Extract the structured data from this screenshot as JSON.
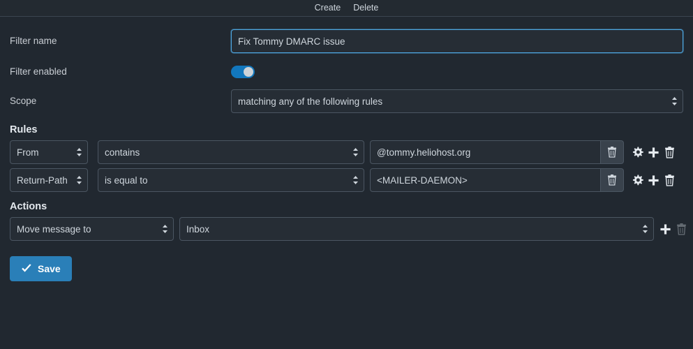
{
  "toolbar": {
    "create_label": "Create",
    "delete_label": "Delete"
  },
  "form": {
    "filter_name_label": "Filter name",
    "filter_name_value": "Fix Tommy DMARC issue",
    "filter_name_placeholder": "",
    "filter_enabled_label": "Filter enabled",
    "filter_enabled_state": "on",
    "scope_label": "Scope",
    "scope_value": "matching any of the following rules"
  },
  "rules": {
    "title": "Rules",
    "rows": [
      {
        "header": "From",
        "operator": "contains",
        "value": "@tommy.heliohost.org"
      },
      {
        "header": "Return-Path",
        "operator": "is equal to",
        "value": "<MAILER-DAEMON>"
      }
    ]
  },
  "actions": {
    "title": "Actions",
    "rows": [
      {
        "type": "Move message to",
        "target": "Inbox"
      }
    ]
  },
  "save": {
    "label": "Save"
  },
  "icons": {
    "delete_value": "trash-icon",
    "rule_settings": "gear-icon",
    "rule_add": "plus-icon",
    "rule_delete": "trash-icon",
    "save_check": "check-icon",
    "select_chevrons": "chevron-updown-icon"
  },
  "colors": {
    "page_background": "#212830",
    "accent_blue": "#2a7fb8",
    "focus_border": "#4ea6e0",
    "toggle_on": "#1277bd",
    "control_border": "#4b5662",
    "control_background": "#262d35",
    "label_text": "#c9ced4"
  }
}
